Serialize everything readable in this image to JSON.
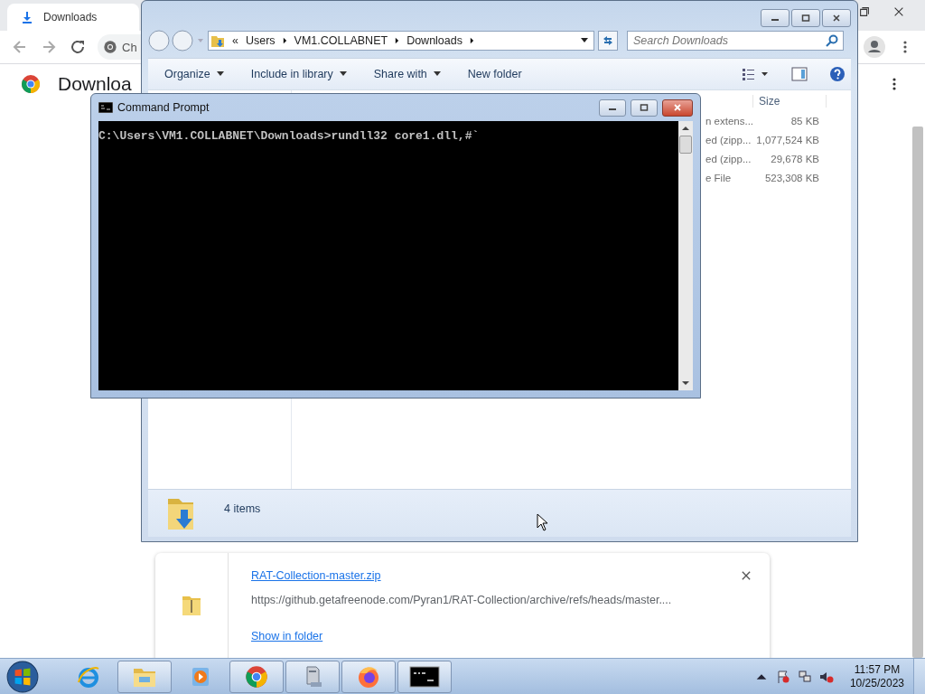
{
  "browser": {
    "tab": {
      "title": "Downloads"
    },
    "omnibox": {
      "text": "Ch"
    },
    "page_title": "Downloa",
    "download": {
      "filename": "RAT-Collection-master.zip",
      "url": "https://github.getafreenode.com/Pyran1/RAT-Collection/archive/refs/heads/master....",
      "action": "Show in folder"
    }
  },
  "explorer": {
    "breadcrumb": {
      "overflow": "«",
      "items": [
        "Users",
        "VM1.COLLABNET",
        "Downloads"
      ]
    },
    "search": {
      "placeholder": "Search Downloads"
    },
    "toolbar": [
      {
        "label": "Organize",
        "dropdown": true
      },
      {
        "label": "Include in library",
        "dropdown": true
      },
      {
        "label": "Share with",
        "dropdown": true
      },
      {
        "label": "New folder",
        "dropdown": false
      }
    ],
    "columns": [
      "Size"
    ],
    "rows": [
      {
        "type": "n extens...",
        "size": "85 KB"
      },
      {
        "type": "ed (zipp...",
        "size": "1,077,524 KB"
      },
      {
        "type": "ed (zipp...",
        "size": "29,678 KB"
      },
      {
        "type": "e File",
        "size": "523,308 KB"
      }
    ],
    "status": "4 items"
  },
  "cmd": {
    "title": "Command Prompt",
    "lines": [
      "C:\\Users\\VM1.COLLABNET\\Downloads>rundll32 core1.dll,#`"
    ]
  },
  "taskbar": {
    "apps": [
      {
        "kind": "ie",
        "running": false
      },
      {
        "kind": "explorer",
        "running": true
      },
      {
        "kind": "media",
        "running": false
      },
      {
        "kind": "chrome",
        "running": true
      },
      {
        "kind": "computer",
        "running": true
      },
      {
        "kind": "firefox",
        "running": true
      },
      {
        "kind": "cmd",
        "running": true
      }
    ],
    "time": "11:57 PM",
    "date": "10/25/2023"
  }
}
